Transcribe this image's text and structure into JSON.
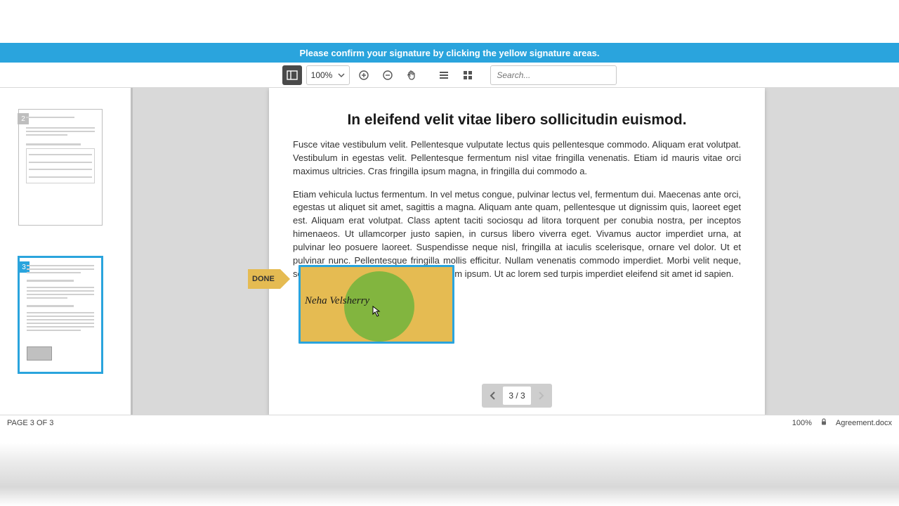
{
  "banner": {
    "message": "Please confirm your signature by clicking the yellow signature areas."
  },
  "toolbar": {
    "zoom_level": "100%",
    "search_placeholder": "Search..."
  },
  "thumbnails": {
    "items": [
      {
        "page": "2"
      },
      {
        "page": "3"
      }
    ],
    "selected_index": 1
  },
  "document": {
    "heading": "In eleifend velit vitae libero sollicitudin euismod.",
    "paragraph1": "Fusce vitae vestibulum velit. Pellentesque vulputate lectus quis pellentesque commodo. Aliquam erat volutpat. Vestibulum in egestas velit. Pellentesque fermentum nisl vitae fringilla venenatis. Etiam id mauris vitae orci maximus ultricies. Cras fringilla ipsum magna, in fringilla dui commodo a.",
    "paragraph2": "Etiam vehicula luctus fermentum. In vel metus congue, pulvinar lectus vel, fermentum dui. Maecenas ante orci, egestas ut aliquet sit amet, sagittis a magna. Aliquam ante quam, pellentesque ut dignissim quis, laoreet eget est. Aliquam erat volutpat. Class aptent taciti sociosqu ad litora torquent per conubia nostra, per inceptos himenaeos. Ut ullamcorper justo sapien, in cursus libero viverra eget. Vivamus auctor imperdiet urna, at pulvinar leo posuere laoreet. Suspendisse neque nisl, fringilla at iaculis scelerisque, ornare vel dolor. Ut et pulvinar nunc. Pellentesque fringilla mollis efficitur. Nullam venenatis commodo imperdiet. Morbi velit neque, semper quis lorem quis, efficitur dignissim ipsum. Ut ac lorem sed turpis imperdiet eleifend sit amet id sapien."
  },
  "signature": {
    "done_label": "DONE",
    "name": "Neha Velsherry"
  },
  "pager": {
    "text": "3 / 3"
  },
  "status": {
    "page_label": "PAGE 3 OF 3",
    "zoom": "100%",
    "filename": "Agreement.docx"
  }
}
